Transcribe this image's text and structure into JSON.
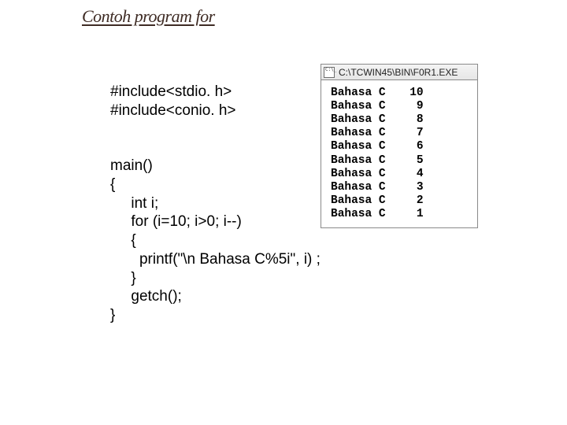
{
  "title": "Contoh program for",
  "code": {
    "l0": "#include<stdio. h>",
    "l1": "#include<conio. h>",
    "l2": "main()",
    "l3": "{",
    "l4": "     int i;",
    "l5": "     for (i=10; i>0; i--)",
    "l6": "     {",
    "l7": "       printf(\"\\n Bahasa C%5i\", i) ;",
    "l8": "     }",
    "l9": "     getch();",
    "l10": "}"
  },
  "console": {
    "title": "C:\\TCWIN45\\BIN\\F0R1.EXE",
    "lines": [
      {
        "label": "Bahasa C",
        "value": "10"
      },
      {
        "label": "Bahasa C",
        "value": "9"
      },
      {
        "label": "Bahasa C",
        "value": "8"
      },
      {
        "label": "Bahasa C",
        "value": "7"
      },
      {
        "label": "Bahasa C",
        "value": "6"
      },
      {
        "label": "Bahasa C",
        "value": "5"
      },
      {
        "label": "Bahasa C",
        "value": "4"
      },
      {
        "label": "Bahasa C",
        "value": "3"
      },
      {
        "label": "Bahasa C",
        "value": "2"
      },
      {
        "label": "Bahasa C",
        "value": "1"
      }
    ]
  }
}
